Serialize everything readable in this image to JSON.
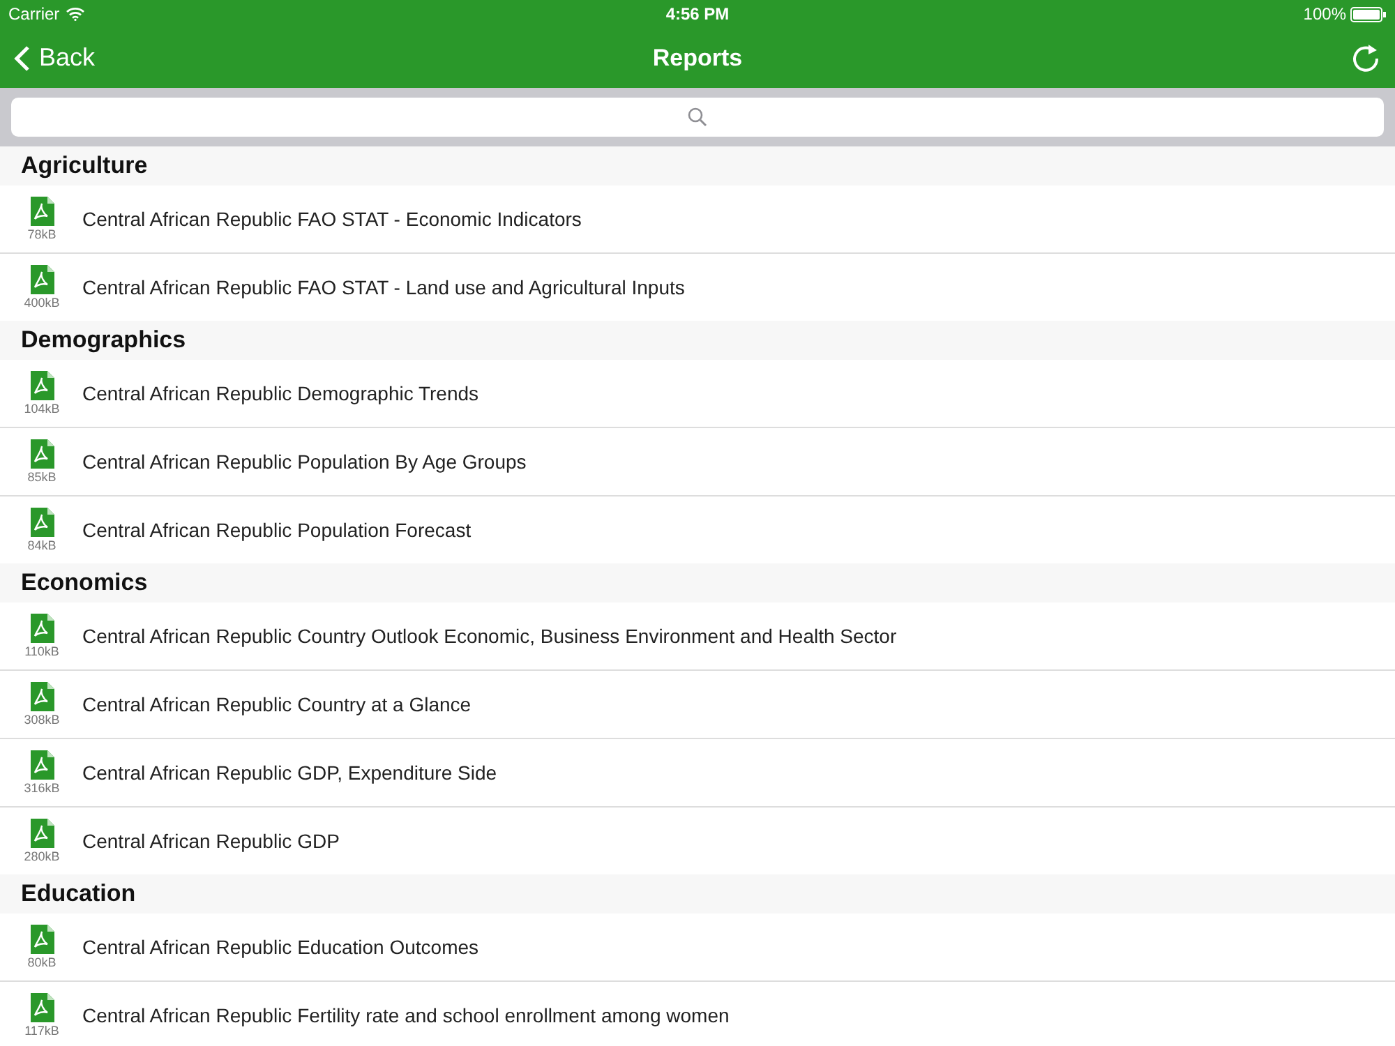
{
  "status_bar": {
    "carrier": "Carrier",
    "time": "4:56 PM",
    "battery": "100%"
  },
  "nav_bar": {
    "back": "Back",
    "title": "Reports"
  },
  "sections": [
    {
      "title": "Agriculture",
      "items": [
        {
          "size": "78kB",
          "title": "Central African Republic FAO STAT - Economic Indicators"
        },
        {
          "size": "400kB",
          "title": "Central African Republic FAO STAT - Land use and Agricultural Inputs"
        }
      ]
    },
    {
      "title": "Demographics",
      "items": [
        {
          "size": "104kB",
          "title": "Central African Republic Demographic Trends"
        },
        {
          "size": "85kB",
          "title": "Central African Republic Population By Age Groups"
        },
        {
          "size": "84kB",
          "title": "Central African Republic Population Forecast"
        }
      ]
    },
    {
      "title": "Economics",
      "items": [
        {
          "size": "110kB",
          "title": "Central African Republic Country Outlook Economic, Business Environment and Health Sector"
        },
        {
          "size": "308kB",
          "title": "Central African Republic Country at a Glance"
        },
        {
          "size": "316kB",
          "title": "Central African Republic GDP, Expenditure Side"
        },
        {
          "size": "280kB",
          "title": "Central African Republic GDP"
        }
      ]
    },
    {
      "title": "Education",
      "items": [
        {
          "size": "80kB",
          "title": "Central African Republic Education Outcomes"
        },
        {
          "size": "117kB",
          "title": "Central African Republic Fertility rate and school enrollment among women"
        }
      ]
    }
  ]
}
